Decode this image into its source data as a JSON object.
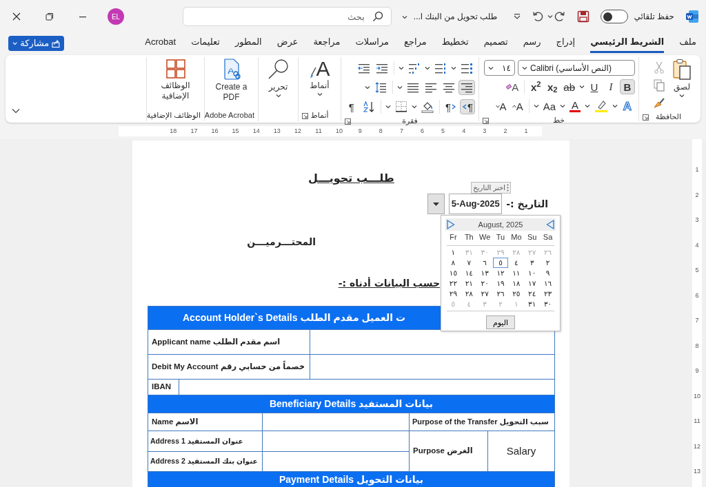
{
  "title_bar": {
    "autosave_label": "حفظ تلقائي",
    "autosave_on": false,
    "document_title": "طلب تحويل من البنك ا...",
    "search_placeholder": "بحث",
    "account_initials": "EL"
  },
  "ribbon_tabs": [
    {
      "label": "ملف",
      "selected": false
    },
    {
      "label": "الشريط الرئيسي",
      "selected": true
    },
    {
      "label": "إدراج",
      "selected": false
    },
    {
      "label": "رسم",
      "selected": false
    },
    {
      "label": "تصميم",
      "selected": false
    },
    {
      "label": "تخطيط",
      "selected": false
    },
    {
      "label": "مراجع",
      "selected": false
    },
    {
      "label": "مراسلات",
      "selected": false
    },
    {
      "label": "مراجعة",
      "selected": false
    },
    {
      "label": "عرض",
      "selected": false
    },
    {
      "label": "المطور",
      "selected": false
    },
    {
      "label": "تعليمات",
      "selected": false
    },
    {
      "label": "Acrobat",
      "selected": false
    }
  ],
  "share_button": "مشاركة",
  "ribbon": {
    "clipboard": {
      "paste": "لصق",
      "label": "الحافظة"
    },
    "font": {
      "font_name": "Calibri (النص الأساسي)",
      "font_size": "١٤",
      "label": "خط",
      "format_buttons": [
        {
          "kind": "bold",
          "glyph": "B",
          "selected": true
        },
        {
          "kind": "italic",
          "glyph": "I",
          "selected": false
        },
        {
          "kind": "underline",
          "glyph": "U",
          "selected": false
        },
        {
          "kind": "strike",
          "glyph": "ab",
          "selected": false
        },
        {
          "kind": "subscript",
          "glyph": "x$_{2}$",
          "selected": false
        },
        {
          "kind": "superscript",
          "glyph": "x$^{2}$",
          "selected": false
        }
      ],
      "clear_glyph": "A",
      "effects_glyph": "A",
      "font_color_glyph": "A",
      "case_glyph": "Aa",
      "grow_glyph": "A",
      "shrink_glyph": "A"
    },
    "paragraph": {
      "label": "فقرة",
      "alignment": [
        {
          "kind": "right",
          "selected": true
        },
        {
          "kind": "center",
          "selected": false
        },
        {
          "kind": "left",
          "selected": false
        },
        {
          "kind": "justify",
          "selected": false
        }
      ],
      "direction": [
        {
          "kind": "rtl",
          "glyph": "¶",
          "selected": true
        },
        {
          "kind": "ltr",
          "glyph": "¶",
          "selected": false
        }
      ],
      "show_marks_glyph": "¶"
    },
    "styles": {
      "glyph": "A",
      "button": "أنماط",
      "label": "أنماط"
    },
    "editing": {
      "button": "تحرير"
    },
    "adobe": {
      "button": "Create a PDF",
      "label": "Adobe Acrobat"
    },
    "addins": {
      "button": "الوظائف الإضافية",
      "label": "الوظائف الإضافية"
    }
  },
  "ruler": {
    "horizontal": [
      "1",
      "2",
      "3",
      "4",
      "5",
      "6",
      "7",
      "8",
      "9",
      "10",
      "11",
      "12",
      "13",
      "14",
      "15",
      "16",
      "17",
      "18"
    ],
    "vertical": [
      "1",
      "2",
      "3",
      "4",
      "5",
      "6",
      "7",
      "8",
      "9",
      "10",
      "11",
      "12",
      "13"
    ]
  },
  "document": {
    "title": "طلـــب تحويـــل",
    "date_label": "التاريخ :-",
    "date_value": "5-Aug-2025",
    "date_tag": "اختر التاريخ",
    "calendar": {
      "month": "August, 2025",
      "weekdays": [
        "Sa",
        "Su",
        "Mo",
        "Tu",
        "We",
        "Th",
        "Fr"
      ],
      "weeks": [
        [
          {
            "day": "٢٦",
            "in_month": false,
            "selected": false
          },
          {
            "day": "٢٧",
            "in_month": false,
            "selected": false
          },
          {
            "day": "٢٨",
            "in_month": false,
            "selected": false
          },
          {
            "day": "٢٩",
            "in_month": false,
            "selected": false
          },
          {
            "day": "٣٠",
            "in_month": false,
            "selected": false
          },
          {
            "day": "٣١",
            "in_month": false,
            "selected": false
          },
          {
            "day": "١",
            "in_month": true,
            "selected": false
          }
        ],
        [
          {
            "day": "٢",
            "in_month": true,
            "selected": false
          },
          {
            "day": "٣",
            "in_month": true,
            "selected": false
          },
          {
            "day": "٤",
            "in_month": true,
            "selected": false
          },
          {
            "day": "٥",
            "in_month": true,
            "selected": true
          },
          {
            "day": "٦",
            "in_month": true,
            "selected": false
          },
          {
            "day": "٧",
            "in_month": true,
            "selected": false
          },
          {
            "day": "٨",
            "in_month": true,
            "selected": false
          }
        ],
        [
          {
            "day": "٩",
            "in_month": true,
            "selected": false
          },
          {
            "day": "١٠",
            "in_month": true,
            "selected": false
          },
          {
            "day": "١١",
            "in_month": true,
            "selected": false
          },
          {
            "day": "١٢",
            "in_month": true,
            "selected": false
          },
          {
            "day": "١٣",
            "in_month": true,
            "selected": false
          },
          {
            "day": "١٤",
            "in_month": true,
            "selected": false
          },
          {
            "day": "١٥",
            "in_month": true,
            "selected": false
          }
        ],
        [
          {
            "day": "١٦",
            "in_month": true,
            "selected": false
          },
          {
            "day": "١٧",
            "in_month": true,
            "selected": false
          },
          {
            "day": "١٨",
            "in_month": true,
            "selected": false
          },
          {
            "day": "١٩",
            "in_month": true,
            "selected": false
          },
          {
            "day": "٢٠",
            "in_month": true,
            "selected": false
          },
          {
            "day": "٢١",
            "in_month": true,
            "selected": false
          },
          {
            "day": "٢٢",
            "in_month": true,
            "selected": false
          }
        ],
        [
          {
            "day": "٢٣",
            "in_month": true,
            "selected": false
          },
          {
            "day": "٢٤",
            "in_month": true,
            "selected": false
          },
          {
            "day": "٢٥",
            "in_month": true,
            "selected": false
          },
          {
            "day": "٢٦",
            "in_month": true,
            "selected": false
          },
          {
            "day": "٢٧",
            "in_month": true,
            "selected": false
          },
          {
            "day": "٢٨",
            "in_month": true,
            "selected": false
          },
          {
            "day": "٢٩",
            "in_month": true,
            "selected": false
          }
        ],
        [
          {
            "day": "٣٠",
            "in_month": true,
            "selected": false
          },
          {
            "day": "٣١",
            "in_month": true,
            "selected": false
          },
          {
            "day": "١",
            "in_month": false,
            "selected": false
          },
          {
            "day": "٢",
            "in_month": false,
            "selected": false
          },
          {
            "day": "٣",
            "in_month": false,
            "selected": false
          },
          {
            "day": "٤",
            "in_month": false,
            "selected": false
          },
          {
            "day": "٥",
            "in_month": false,
            "selected": false
          }
        ]
      ],
      "today_button": "اليوم"
    },
    "salutation": "المحتـــرميـــن",
    "intro": "حسب البيانات أدناه :-",
    "account_holder": {
      "header": "Account Holder`s Details ت العميل مقدم الطلب",
      "rows": [
        "Applicant name اسم مقدم الطلب",
        "Debit My Account خصماً من حسابي رقم"
      ],
      "iban_label": "IBAN"
    },
    "beneficiary": {
      "header": "Beneficiary Details بيانات المستفيد",
      "name_label": "Name الاسم",
      "address_labels": [
        "Address 1 عنوان المستفيد",
        "Address 2 عنوان بنك المستفيد"
      ],
      "purpose_heading": "Purpose of the Transfer سبب التحويل",
      "purpose_label": "Purpose الغرض",
      "purpose_value": "Salary"
    },
    "payment": {
      "header": "Payment Details بيانات التحويل"
    }
  }
}
